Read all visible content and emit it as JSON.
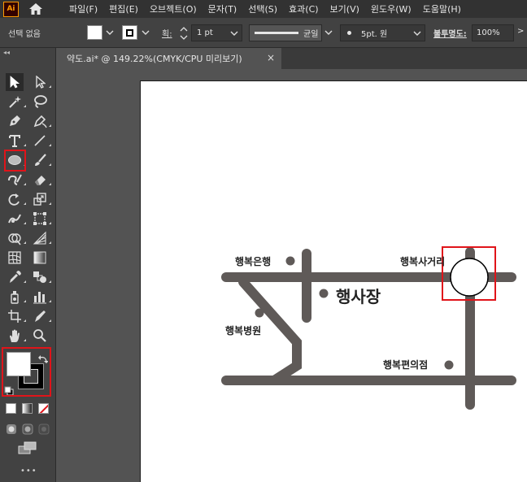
{
  "app": {
    "logo_text": "Ai"
  },
  "menu": [
    "파일(F)",
    "편집(E)",
    "오브젝트(O)",
    "문자(T)",
    "선택(S)",
    "효과(C)",
    "보기(V)",
    "윈도우(W)",
    "도움말(H)"
  ],
  "control_bar": {
    "selection_status": "선택 없음",
    "stroke_label": "획:",
    "stroke_weight": "1 pt",
    "profile_label": "균일",
    "brush_label": "5pt. 원",
    "opacity_label": "불투명도:",
    "opacity_value": "100%",
    "more": ">"
  },
  "document_tab": {
    "title": "약도.ai* @ 149.22%(CMYK/CPU 미리보기)",
    "close": "×"
  },
  "toolbox": {
    "collapse": "◂◂",
    "more_tools": "•••",
    "fill_color": "#ffffff",
    "stroke_color": "#000000"
  },
  "map": {
    "road_color": "#5f5a58",
    "labels": {
      "bank": "행복은행",
      "crossroad": "행복사거리",
      "venue": "행사장",
      "hospital": "행복병원",
      "store": "행복편의점"
    }
  },
  "colors": {
    "highlight_box": "#e0141a",
    "menubar": "#323232",
    "panel": "#424242",
    "workspace": "#535353"
  }
}
